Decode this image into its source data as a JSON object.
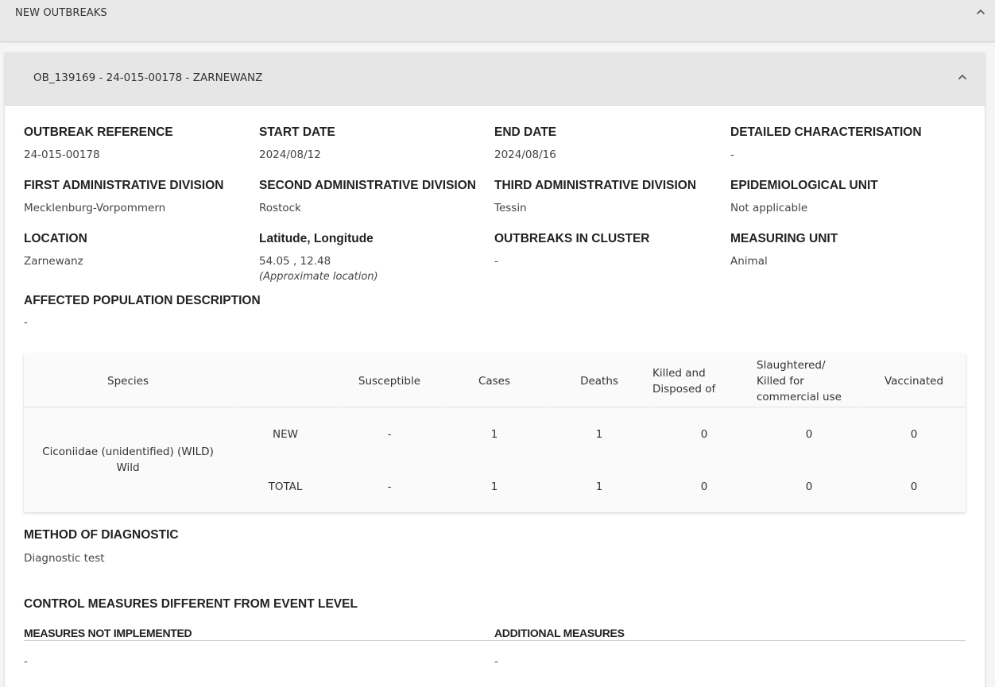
{
  "section": {
    "title": "NEW OUTBREAKS",
    "toggle_icon": "chevron-up-icon"
  },
  "outbreak": {
    "header_title": "OB_139169 - 24-015-00178 - ZARNEWANZ",
    "toggle_icon": "chevron-up-icon",
    "fields": {
      "outbreak_reference": {
        "label": "OUTBREAK REFERENCE",
        "value": "24-015-00178"
      },
      "start_date": {
        "label": "START DATE",
        "value": "2024/08/12"
      },
      "end_date": {
        "label": "END DATE",
        "value": "2024/08/16"
      },
      "detailed_characterisation": {
        "label": "DETAILED CHARACTERISATION",
        "value": "-"
      },
      "first_admin_division": {
        "label": "FIRST ADMINISTRATIVE DIVISION",
        "value": "Mecklenburg-Vorpommern"
      },
      "second_admin_division": {
        "label": "SECOND ADMINISTRATIVE DIVISION",
        "value": "Rostock"
      },
      "third_admin_division": {
        "label": "THIRD ADMINISTRATIVE DIVISION",
        "value": "Tessin"
      },
      "epidemiological_unit": {
        "label": "EPIDEMIOLOGICAL UNIT",
        "value": "Not applicable"
      },
      "location": {
        "label": "LOCATION",
        "value": "Zarnewanz"
      },
      "lat_long": {
        "label": "Latitude, Longitude",
        "value": "54.05 , 12.48",
        "note": "(Approximate location)"
      },
      "outbreaks_in_cluster": {
        "label": "OUTBREAKS IN CLUSTER",
        "value": "-"
      },
      "measuring_unit": {
        "label": "MEASURING UNIT",
        "value": "Animal"
      },
      "affected_population": {
        "label": "AFFECTED POPULATION DESCRIPTION",
        "value": "-"
      }
    },
    "species_table": {
      "headers": {
        "species": "Species",
        "susceptible": "Susceptible",
        "cases": "Cases",
        "deaths": "Deaths",
        "killed_line1": "Killed and",
        "killed_line2": "Disposed of",
        "slaughtered_line1": "Slaughtered/",
        "slaughtered_line2": "Killed for",
        "slaughtered_line3": "commercial use",
        "vaccinated": "Vaccinated"
      },
      "species_name_line1": "Ciconiidae (unidentified) (WILD)",
      "species_name_line2": "Wild",
      "rows": [
        {
          "type": "NEW",
          "susceptible": "-",
          "cases": "1",
          "deaths": "1",
          "killed": "0",
          "slaughtered": "0",
          "vaccinated": "0"
        },
        {
          "type": "TOTAL",
          "susceptible": "-",
          "cases": "1",
          "deaths": "1",
          "killed": "0",
          "slaughtered": "0",
          "vaccinated": "0"
        }
      ]
    },
    "method_of_diagnostic": {
      "label": "METHOD OF DIAGNOSTIC",
      "value": "Diagnostic test"
    },
    "control_measures": {
      "title": "CONTROL MEASURES DIFFERENT FROM EVENT LEVEL",
      "not_implemented_label": "MEASURES NOT IMPLEMENTED",
      "not_implemented_value": "-",
      "additional_label": "ADDITIONAL MEASURES",
      "additional_value": "-"
    }
  }
}
